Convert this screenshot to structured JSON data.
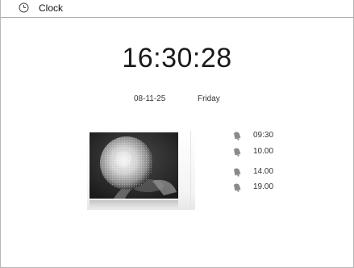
{
  "window": {
    "title": "Clock",
    "title_icon": "clock-icon"
  },
  "clock": {
    "time": "16:30:28",
    "date": "08-11-25",
    "weekday": "Friday"
  },
  "photo": {
    "subject_icon": "flower-photo"
  },
  "alarms": [
    {
      "time": "09:30",
      "icon": "bell-icon"
    },
    {
      "time": "10.00",
      "icon": "bell-icon"
    },
    {
      "time": "14.00",
      "icon": "bell-icon"
    },
    {
      "time": "19.00",
      "icon": "bell-icon"
    }
  ],
  "colors": {
    "text": "#2a2a2a",
    "border": "#b8b8b8",
    "icon": "#8a8a8a"
  }
}
